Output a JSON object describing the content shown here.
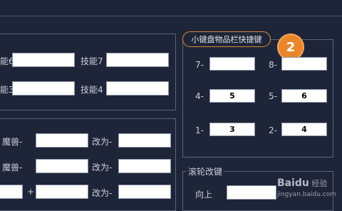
{
  "skills_panel": {
    "labels": {
      "skill_left_top": "能6",
      "skill7": "技能7",
      "skill_left_bottom": "能3",
      "skill4": "技能4"
    }
  },
  "quickbar_panel": {
    "title": "小键盘物品栏快捷键",
    "badge": "2",
    "slots": [
      {
        "label": "7-",
        "value": ""
      },
      {
        "label": "8-",
        "value": ""
      },
      {
        "label": "4-",
        "value": "5"
      },
      {
        "label": "5-",
        "value": "6"
      },
      {
        "label": "1-",
        "value": "3"
      },
      {
        "label": "2-",
        "value": "4"
      }
    ]
  },
  "pet_panel": {
    "row1": {
      "label": "魔兽-",
      "change": "改为-"
    },
    "row2": {
      "label": "魔兽-",
      "change": "改为-"
    },
    "row3": {
      "sep": "+",
      "change": "改为-"
    }
  },
  "wheel_panel": {
    "title": "滚轮改键",
    "up_label": "向上"
  },
  "watermark": {
    "brand": "Baidu",
    "text": "经验",
    "url": "jingyan.baidu.com"
  }
}
